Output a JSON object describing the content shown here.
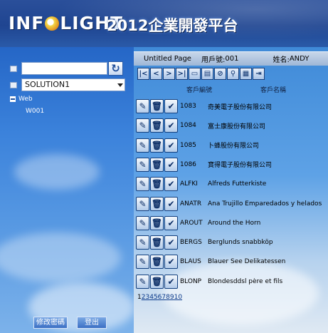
{
  "header": {
    "logo_text": "INF",
    "logo_text_end": "LIGHT",
    "platform_title": "2012企業開發平台"
  },
  "sidebar": {
    "search_value": "",
    "refresh_icon": "refresh-arrow-icon",
    "solution_value": "SOLUTION1",
    "tree": {
      "root_label": "Web",
      "child_label": "W001"
    },
    "buttons": {
      "change_password": "修改密碼",
      "logout": "登出"
    }
  },
  "topbar": {
    "page_title": "Untitled Page",
    "user_label": "用戶號:",
    "user_value": "001",
    "name_label": "姓名:",
    "name_value": "ANDY"
  },
  "toolbar": {
    "buttons": [
      "first-page-icon",
      "previous-page-icon",
      "next-page-icon",
      "last-page-icon",
      "open-icon",
      "print-preview-icon",
      "cancel-icon",
      "search-icon",
      "print-icon",
      "export-icon"
    ]
  },
  "grid": {
    "headers": {
      "customer_id": "客戶編號",
      "customer_name": "客戶名稱"
    },
    "rows": [
      {
        "id": "1083",
        "name": "奇美電子股份有限公司"
      },
      {
        "id": "1084",
        "name": "富士康股份有限公司"
      },
      {
        "id": "1085",
        "name": "卜蜂股份有限公司"
      },
      {
        "id": "1086",
        "name": "寶得電子股份有限公司"
      },
      {
        "id": "ALFKI",
        "name": "Alfreds Futterkiste"
      },
      {
        "id": "ANATR",
        "name": "Ana Trujillo Emparedados y helados"
      },
      {
        "id": "AROUT",
        "name": "Around the Horn"
      },
      {
        "id": "BERGS",
        "name": "Berglunds snabbköp"
      },
      {
        "id": "BLAUS",
        "name": "Blauer See Delikatessen"
      },
      {
        "id": "BLONP",
        "name": "Blondesddsl père et fils"
      }
    ],
    "pager": [
      "1",
      "2",
      "3",
      "4",
      "5",
      "6",
      "7",
      "8",
      "9",
      "10"
    ]
  }
}
